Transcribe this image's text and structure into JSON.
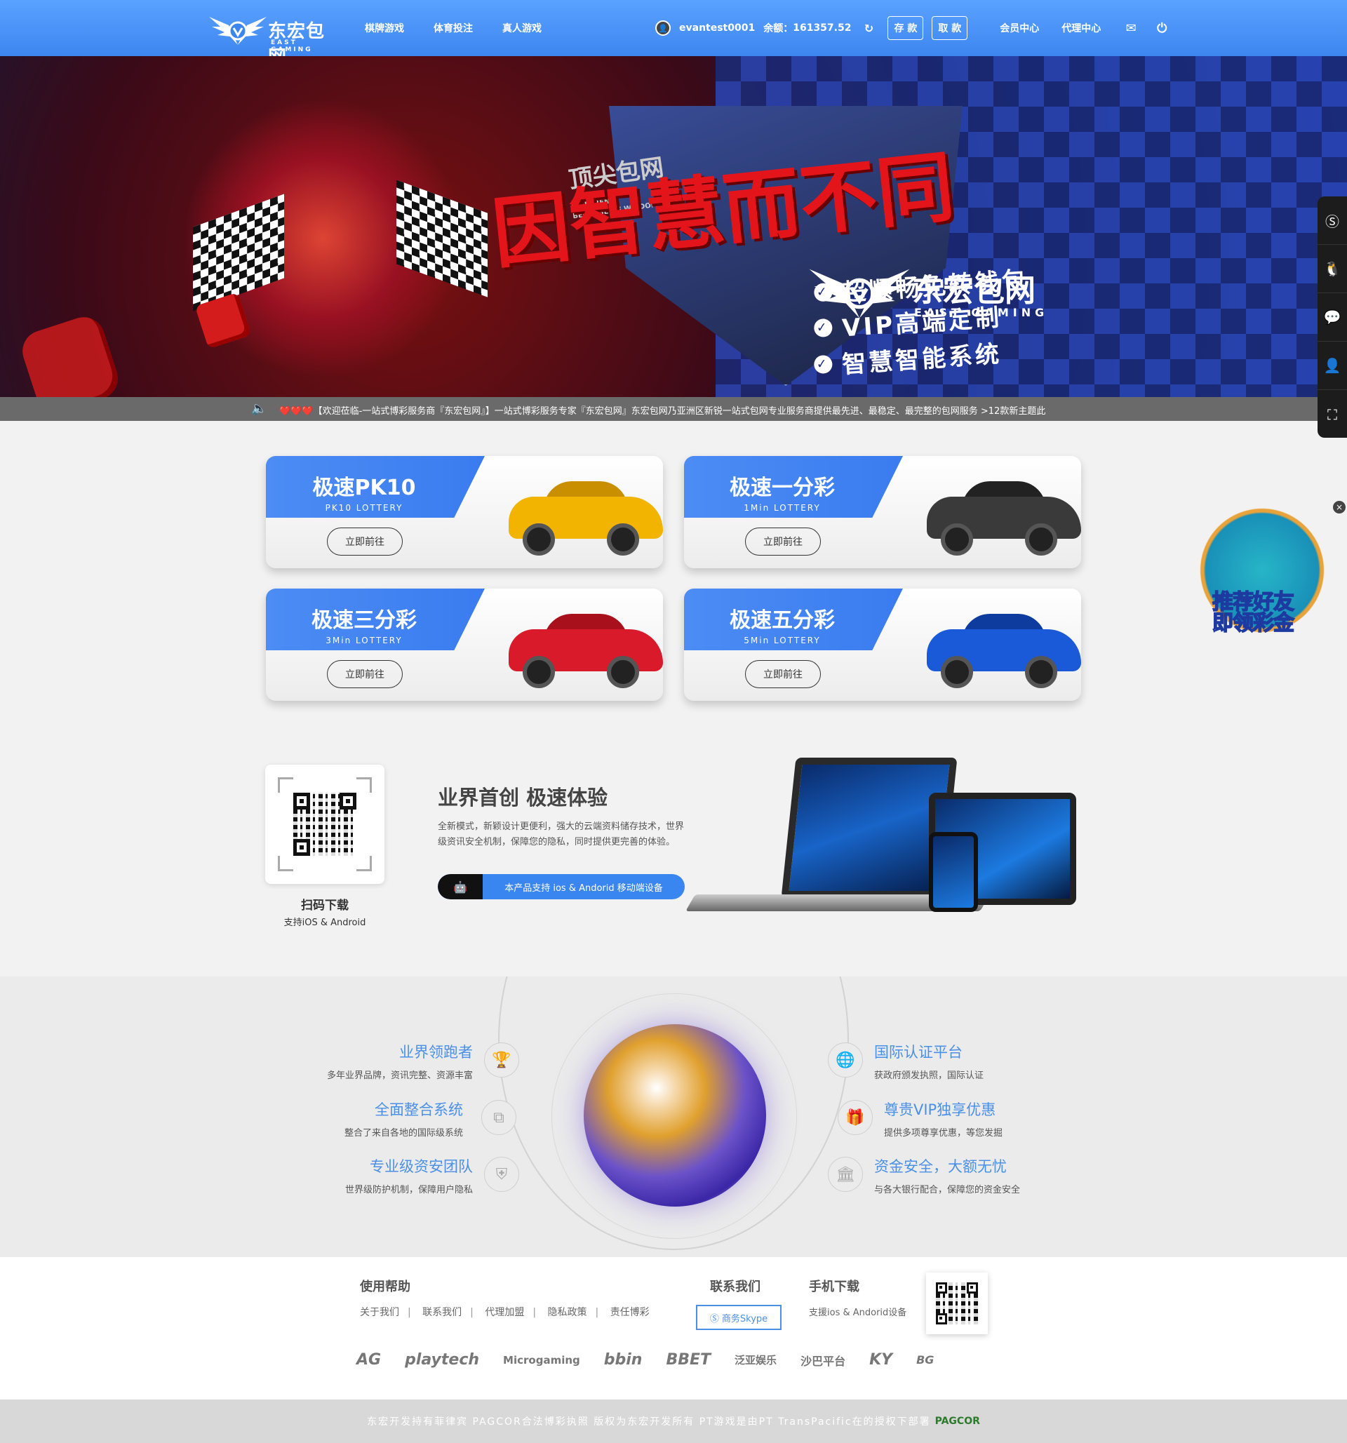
{
  "header": {
    "logo_text": "东宏包网",
    "logo_sub": "EAST GAMING",
    "nav": [
      "棋牌游戏",
      "体育投注",
      "真人游戏"
    ],
    "username": "evantest0001",
    "balance_label": "余额：",
    "balance_value": "161357.52",
    "deposit_label": "存 款",
    "withdraw_label": "取 款",
    "member_center": "会员中心",
    "agent_center": "代理中心",
    "icons": [
      "refresh-icon",
      "mail-icon",
      "logout-icon"
    ]
  },
  "banner": {
    "top_text": "顶尖包网",
    "tag_en_1": "DIFFERENT",
    "tag_en_2": "BECAUSE OF WISDOM",
    "headline": "因智慧而不同",
    "brand": "东宏包网",
    "brand_sub": "EAST GAMING",
    "features": [
      "超顺畅免转钱包",
      "VIP高端定制",
      "智慧智能系统"
    ],
    "slide_count": 3,
    "active_slide": 3
  },
  "ticker": {
    "hearts": "❤️❤️❤️",
    "text": "【欢迎莅临-一站式博彩服务商『东宏包网』】一站式博彩服务专家『东宏包网』东宏包网乃亚洲区新锐一站式包网专业服务商提供最先进、最稳定、最完整的包网服务 >12款新主题此"
  },
  "side_icons": [
    "skype-icon",
    "qq-icon",
    "chat-icon",
    "user-icon",
    "scan-icon"
  ],
  "promo": {
    "line1": "推荐好友",
    "line2": "即领彩金",
    "close": "×"
  },
  "lottery_cards": [
    {
      "title": "极速PK10",
      "sub": "PK10 LOTTERY",
      "button": "立即前往",
      "car_color": "#f2b400"
    },
    {
      "title": "极速一分彩",
      "sub": "1Min LOTTERY",
      "button": "立即前往",
      "car_color": "#3a3a3a"
    },
    {
      "title": "极速三分彩",
      "sub": "3Min LOTTERY",
      "button": "立即前往",
      "car_color": "#d81a2a"
    },
    {
      "title": "极速五分彩",
      "sub": "5Min LOTTERY",
      "button": "立即前往",
      "car_color": "#1a5ad8"
    }
  ],
  "app": {
    "scan_title": "扫码下载",
    "scan_sub": "支持iOS & Android",
    "heading": "业界首创 极速体验",
    "desc": "全新模式，新颖设计更便利，强大的云端资料储存技术，世界级资讯安全机制，保障您的隐私，同时提供更完善的体验。",
    "pill_label": "本产品支持 ios & Andorid 移动端设备"
  },
  "features": {
    "left": [
      {
        "title": "业界领跑者",
        "desc": "多年业界品牌，资讯完整、资源丰富",
        "icon": "trophy-icon"
      },
      {
        "title": "全面整合系统",
        "desc": "整合了来自各地的国际级系统",
        "icon": "network-icon"
      },
      {
        "title": "专业级资安团队",
        "desc": "世界级防护机制，保障用户隐私",
        "icon": "shield-icon"
      }
    ],
    "right": [
      {
        "title": "国际认证平台",
        "desc": "获政府颁发执照，国际认证",
        "icon": "globe-icon"
      },
      {
        "title": "尊贵VIP独享优惠",
        "desc": "提供多项尊享优惠，等您发掘",
        "icon": "gift-icon"
      },
      {
        "title": "资金安全，大额无忧",
        "desc": "与各大银行配合，保障您的资金安全",
        "icon": "bank-icon"
      }
    ]
  },
  "footer": {
    "help_title": "使用帮助",
    "help_links": [
      "关于我们",
      "联系我们",
      "代理加盟",
      "隐私政策",
      "责任博彩"
    ],
    "contact_title": "联系我们",
    "skype_label": "商务Skype",
    "download_title": "手机下载",
    "download_desc": "支援ios & Andorid设备",
    "partners": [
      "AG",
      "playtech",
      "Microgaming",
      "bbin",
      "BBET",
      "泛亚娱乐",
      "沙巴平台",
      "KY",
      "BG"
    ]
  },
  "bottom": {
    "text": "东宏开发持有菲律宾 PAGCOR合法博彩执照 版权为东宏开发所有 PT游戏是由PT TransPacific在的授权下部署",
    "badge": "PAGCOR"
  }
}
